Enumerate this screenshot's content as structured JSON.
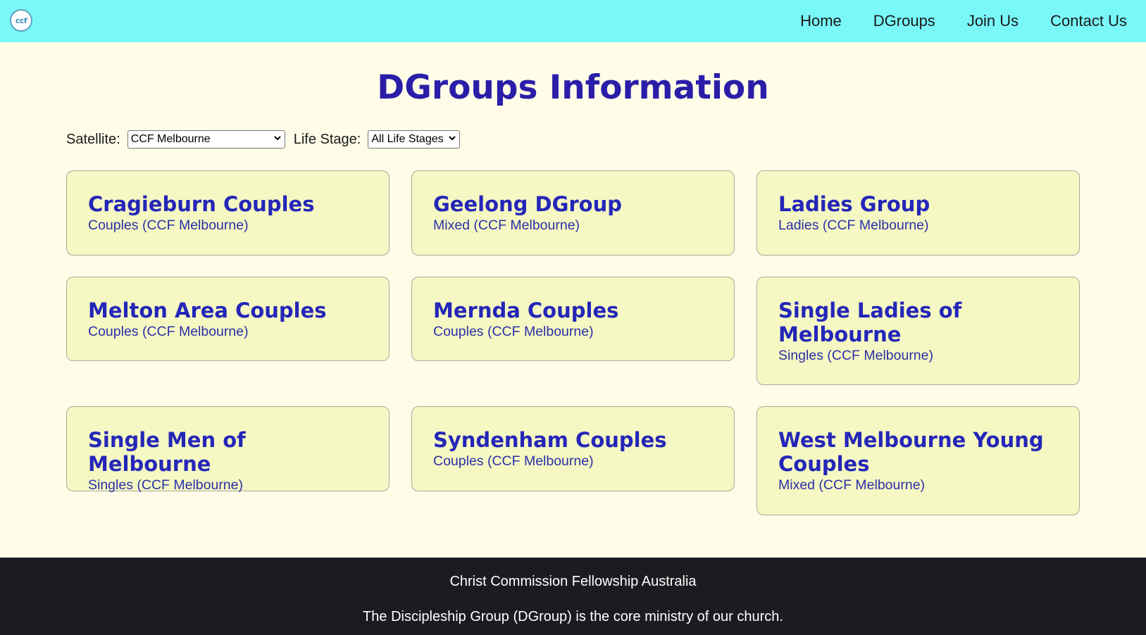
{
  "header": {
    "logo_text": "ccf",
    "nav": [
      "Home",
      "DGroups",
      "Join Us",
      "Contact Us"
    ]
  },
  "page": {
    "title": "DGroups Information"
  },
  "filters": {
    "satellite_label": "Satellite:",
    "satellite_value": "CCF Melbourne",
    "life_stage_label": "Life Stage:",
    "life_stage_value": "All Life Stages"
  },
  "cards": [
    {
      "title": "Cragieburn Couples",
      "subtitle": "Couples (CCF Melbourne)"
    },
    {
      "title": "Geelong DGroup",
      "subtitle": "Mixed (CCF Melbourne)"
    },
    {
      "title": "Ladies Group",
      "subtitle": "Ladies (CCF Melbourne)"
    },
    {
      "title": "Melton Area Couples",
      "subtitle": "Couples (CCF Melbourne)"
    },
    {
      "title": "Mernda Couples",
      "subtitle": "Couples (CCF Melbourne)"
    },
    {
      "title": "Single Ladies of Melbourne",
      "subtitle": "Singles (CCF Melbourne)"
    },
    {
      "title": "Single Men of Melbourne",
      "subtitle": "Singles (CCF Melbourne)"
    },
    {
      "title": "Syndenham Couples",
      "subtitle": "Couples (CCF Melbourne)"
    },
    {
      "title": "West Melbourne Young Couples",
      "subtitle": "Mixed (CCF Melbourne)"
    }
  ],
  "footer": {
    "line1": "Christ Commission Fellowship Australia",
    "line2": "The Discipleship Group (DGroup) is the core ministry of our church."
  },
  "colors": {
    "header_bg": "#7af7f8",
    "page_bg": "#fffde8",
    "card_bg": "#f5f8c2",
    "title_color": "#2a1ea8",
    "footer_bg": "#1b1c20"
  }
}
